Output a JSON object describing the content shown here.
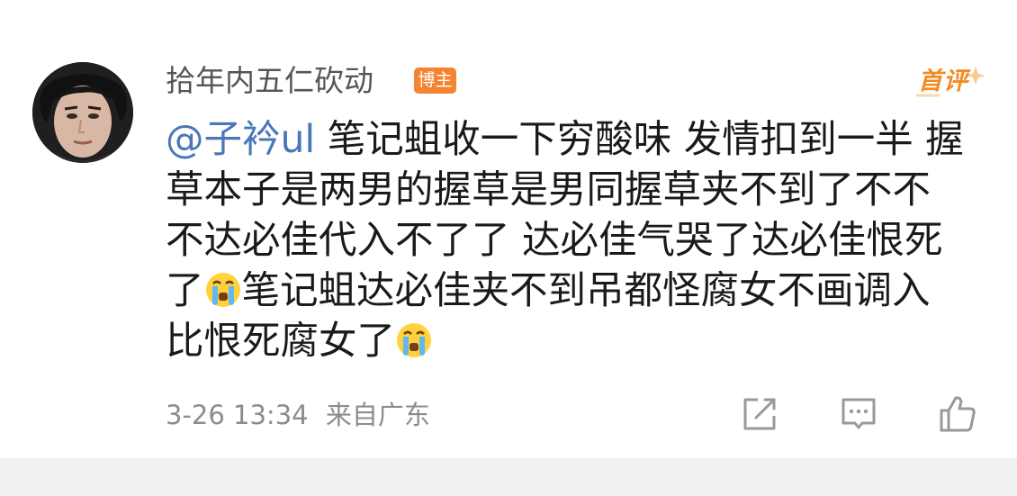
{
  "comment": {
    "author": "拾年内五仁砍动",
    "author_badge": "博主",
    "first_comment_label": "首评",
    "mention": "@子衿ul",
    "lines": [
      " 笔记蛆收一下穷酸味 发情扣到一半 握",
      "草本子是两男的握草是男同握草夹不到了不不",
      "不达必佳代入不了了 达必佳气哭了达必佳恨死",
      "笔记蛆达必佳夹不到吊都怪腐女不画调入",
      "比恨死腐女了"
    ],
    "line4_prefix": "了",
    "emoji": "crying-face",
    "timestamp": "3-26 13:34",
    "location": "来自广东"
  },
  "actions": [
    {
      "name": "share-icon",
      "semantic": "share"
    },
    {
      "name": "comment-icon",
      "semantic": "reply"
    },
    {
      "name": "like-icon",
      "semantic": "like"
    }
  ],
  "colors": {
    "mention": "#4a76ba",
    "badge": "#f58432",
    "first_comment": "#f28a1f",
    "meta": "#8c8c8c"
  }
}
